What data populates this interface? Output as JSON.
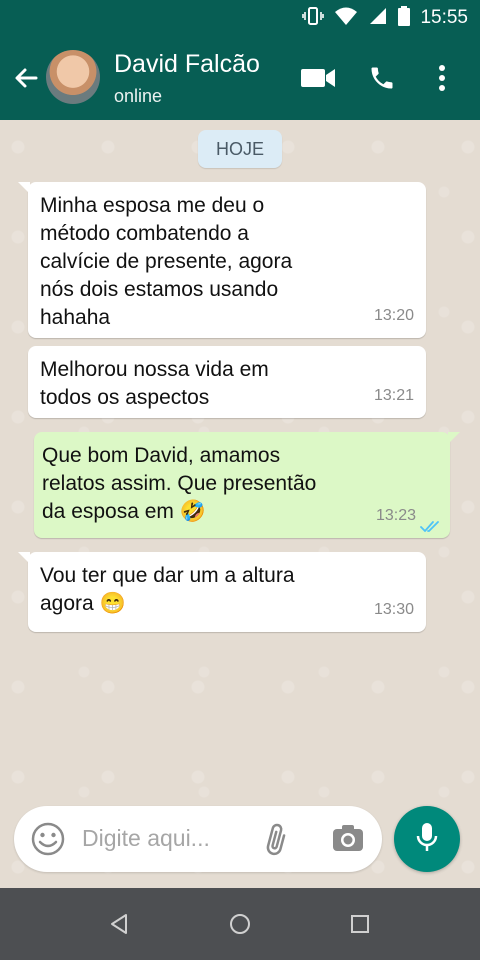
{
  "status_bar": {
    "time": "15:55"
  },
  "header": {
    "contact_name": "David Falcão",
    "contact_status": "online"
  },
  "chat": {
    "date_chip": "HOJE",
    "messages": [
      {
        "direction": "in",
        "lines": [
          "Minha esposa me deu o",
          "método combatendo a",
          "calvície de presente, agora",
          "nós dois estamos usando",
          "hahaha"
        ],
        "time": "13:20"
      },
      {
        "direction": "in",
        "lines": [
          "Melhorou nossa vida em",
          "todos os aspectos"
        ],
        "time": "13:21"
      },
      {
        "direction": "out",
        "lines": [
          "Que bom David, amamos",
          "relatos assim. Que presentão",
          "da esposa em 🤣"
        ],
        "time": "13:23",
        "read": true
      },
      {
        "direction": "in",
        "lines": [
          "Vou ter que dar um a altura",
          "agora 😁"
        ],
        "time": "13:30"
      }
    ]
  },
  "composer": {
    "placeholder": "Digite aqui..."
  },
  "colors": {
    "header": "#075e54",
    "outgoing_bubble": "#dcf8c6",
    "incoming_bubble": "#ffffff",
    "mic_button": "#00897b",
    "read_ticks": "#4fc3f7"
  },
  "icons": [
    "vibrate-icon",
    "wifi-icon",
    "signal-icon",
    "battery-icon",
    "back-arrow-icon",
    "video-call-icon",
    "phone-icon",
    "more-options-icon",
    "emoji-icon",
    "attach-icon",
    "camera-icon",
    "mic-icon",
    "nav-back-icon",
    "nav-home-icon",
    "nav-recents-icon",
    "double-check-icon"
  ]
}
